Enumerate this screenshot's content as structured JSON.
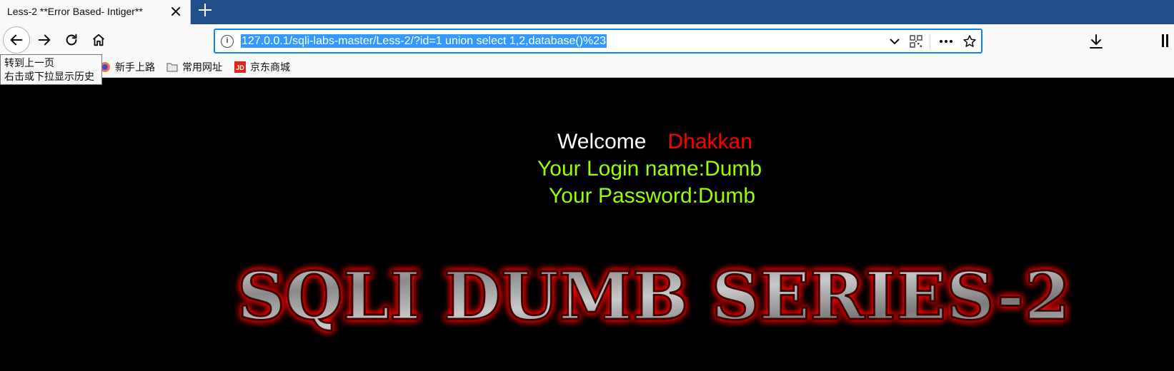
{
  "tab": {
    "title": "Less-2 **Error Based- Intiger**"
  },
  "address_bar": {
    "url": "127.0.0.1/sqli-labs-master/Less-2/?id=1 union select 1,2,database()%23"
  },
  "tooltip": {
    "line1": "转到上一页",
    "line2": "右击或下拉显示历史"
  },
  "bookmarks": [
    {
      "label": "新手上路",
      "icon": "firefox-icon"
    },
    {
      "label": "常用网址",
      "icon": "folder-icon"
    },
    {
      "label": "京东商城",
      "icon": "jd-icon"
    }
  ],
  "page": {
    "welcome": "Welcome",
    "user_name": "Dhakkan",
    "login_line": "Your Login name:Dumb",
    "password_line": "Your Password:Dumb",
    "banner": "SQLI DUMB SERIES-2"
  },
  "colors": {
    "tab_strip": "#1f4e8a",
    "page_background": "#000000",
    "welcome_text": "#ffffff",
    "user_name_text": "#ff0000",
    "credential_text": "#99ff00",
    "url_selection": "#3399ff"
  }
}
